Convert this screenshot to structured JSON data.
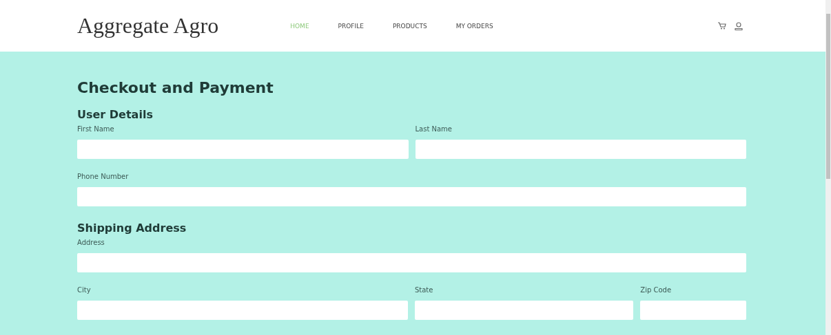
{
  "brand": "Aggregate Agro",
  "nav": [
    {
      "label": "HOME",
      "selected": true
    },
    {
      "label": "PROFILE",
      "selected": false
    },
    {
      "label": "PRODUCTS",
      "selected": false
    },
    {
      "label": "MY ORDERS",
      "selected": false
    }
  ],
  "page_title": "Checkout and Payment",
  "sections": [
    {
      "title": "User Details",
      "rows": [
        [
          {
            "label": "First Name"
          },
          {
            "label": "Last Name"
          }
        ],
        [
          {
            "label": "Phone Number"
          }
        ]
      ]
    },
    {
      "title": "Shipping Address",
      "rows": [
        [
          {
            "label": "Address"
          }
        ],
        [
          {
            "label": "City"
          },
          {
            "label": "State"
          },
          {
            "label": "Zip Code"
          }
        ]
      ]
    }
  ]
}
